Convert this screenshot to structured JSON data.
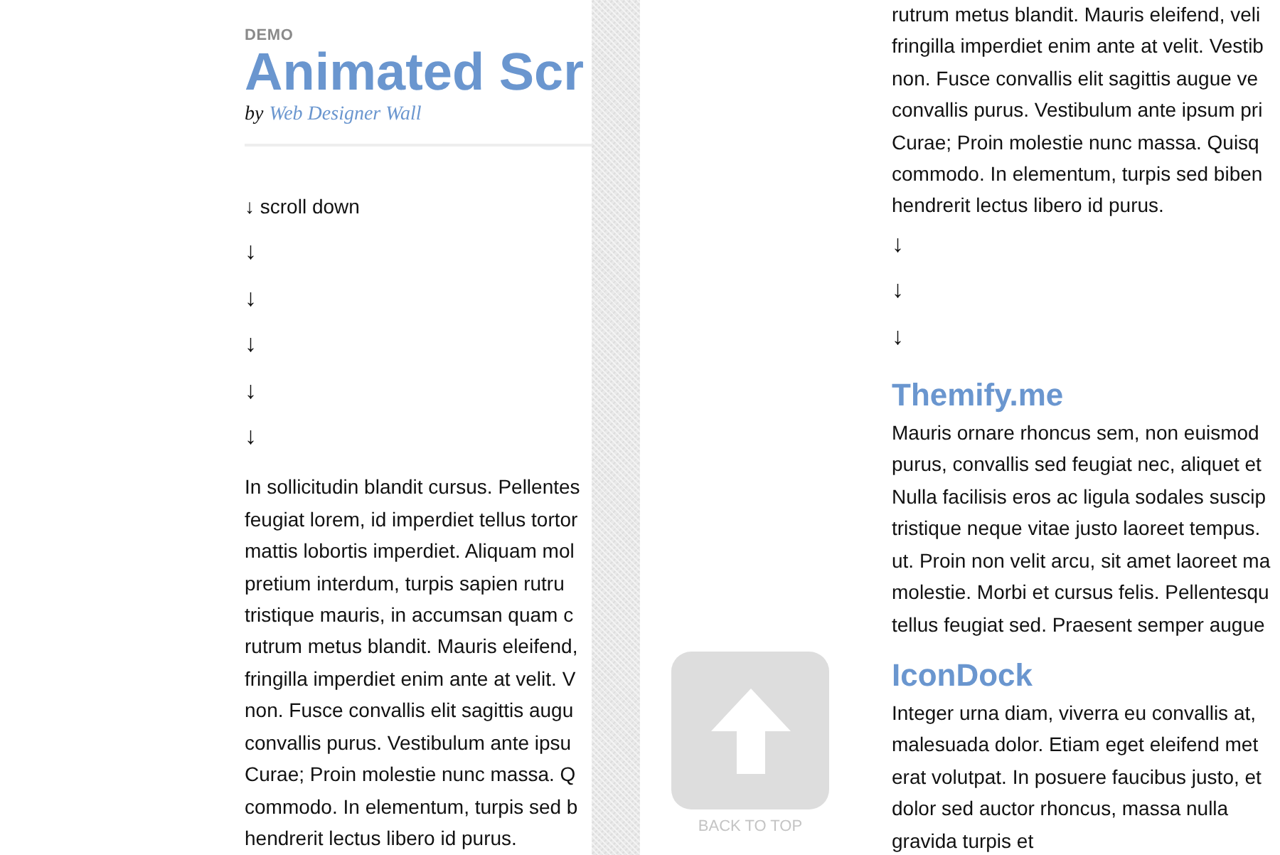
{
  "left_page": {
    "eyebrow": "DEMO",
    "title": "Animated Scr",
    "byline": {
      "prefix": "by",
      "author": "Web Designer Wall"
    },
    "scroll_hint": "↓ scroll down",
    "arrows": [
      "↓",
      "↓",
      "↓",
      "↓",
      "↓"
    ],
    "paragraph_lines": [
      "In sollicitudin blandit cursus. Pellentes",
      "feugiat lorem, id imperdiet tellus tortor",
      "mattis lobortis imperdiet. Aliquam mol",
      "pretium interdum, turpis sapien rutru",
      "tristique mauris, in accumsan quam c",
      "rutrum metus blandit. Mauris eleifend,",
      "fringilla imperdiet enim ante at velit. V",
      "non. Fusce convallis elit sagittis augu",
      "convallis purus. Vestibulum ante ipsu",
      "Curae; Proin molestie nunc massa. Q",
      "commodo. In elementum, turpis sed b",
      "hendrerit lectus libero id purus."
    ]
  },
  "right_page": {
    "lines": [
      "rutrum metus blandit. Mauris eleifend, veli",
      "fringilla imperdiet enim ante at velit. Vestib",
      "non. Fusce convallis elit sagittis augue ve",
      "convallis purus. Vestibulum ante ipsum pri",
      "Curae; Proin molestie nunc massa. Quisq",
      "commodo. In elementum, turpis sed biben",
      "hendrerit lectus libero id purus."
    ],
    "arrows": [
      "↓",
      "↓",
      "↓"
    ],
    "sections": [
      {
        "heading": "Themify.me",
        "lines": [
          "Mauris ornare rhoncus sem, non euismod",
          "purus, convallis sed feugiat nec, aliquet et",
          "Nulla facilisis eros ac ligula sodales suscip",
          "tristique neque vitae justo laoreet tempus.",
          "ut. Proin non velit arcu, sit amet laoreet ma",
          "molestie. Morbi et cursus felis. Pellentesqu",
          "tellus feugiat sed. Praesent semper augue"
        ]
      },
      {
        "heading": "IconDock",
        "lines": [
          "Integer urna diam, viverra eu convallis at,",
          "malesuada dolor. Etiam eget eleifend met",
          "erat volutpat. In posuere faucibus justo, et",
          "dolor sed auctor rhoncus, massa nulla",
          "gravida turpis et"
        ]
      }
    ]
  },
  "back_to_top": {
    "label": "BACK TO TOP"
  }
}
